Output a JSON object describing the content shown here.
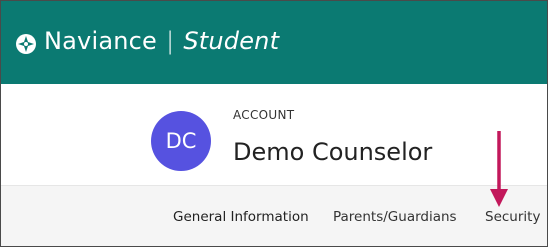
{
  "header": {
    "brand_name": "Naviance",
    "brand_divider": "|",
    "product_name": "Student",
    "logo_icon": "compass-icon",
    "background_color": "#0b7a72"
  },
  "account": {
    "label": "ACCOUNT",
    "avatar_initials": "DC",
    "avatar_color": "#5652e0",
    "user_name": "Demo Counselor"
  },
  "tabs": [
    {
      "label": "General Information"
    },
    {
      "label": "Parents/Guardians"
    },
    {
      "label": "Security"
    }
  ],
  "annotation": {
    "arrow_icon": "arrow-down-icon",
    "arrow_color": "#c2185b"
  }
}
